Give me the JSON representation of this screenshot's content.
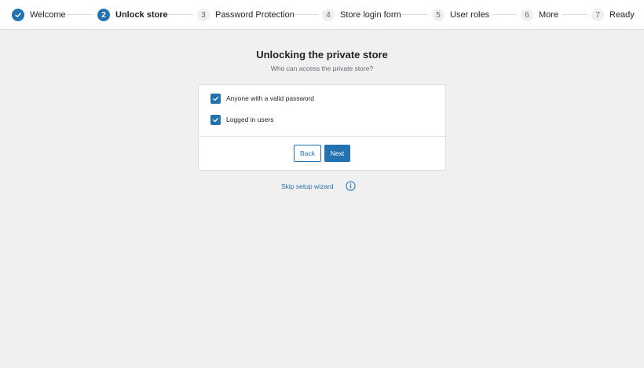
{
  "stepper": {
    "steps": [
      {
        "number": "",
        "label": "Welcome",
        "state": "done"
      },
      {
        "number": "2",
        "label": "Unlock store",
        "state": "active"
      },
      {
        "number": "3",
        "label": "Password Protection",
        "state": "todo"
      },
      {
        "number": "4",
        "label": "Store login form",
        "state": "todo"
      },
      {
        "number": "5",
        "label": "User roles",
        "state": "todo"
      },
      {
        "number": "6",
        "label": "More",
        "state": "todo"
      },
      {
        "number": "7",
        "label": "Ready",
        "state": "todo"
      }
    ]
  },
  "main": {
    "title": "Unlocking the private store",
    "subtitle": "Who can access the private store?",
    "options": [
      {
        "label": "Anyone with a valid password",
        "checked": true
      },
      {
        "label": "Logged in users",
        "checked": true
      }
    ],
    "back_label": "Back",
    "next_label": "Next",
    "skip_label": "Skip setup wizard"
  },
  "colors": {
    "accent": "#2271b1",
    "background": "#f0f0f1",
    "card": "#ffffff"
  },
  "icons": {
    "done_step": "check-icon",
    "checkbox": "check-icon",
    "help": "info-icon"
  }
}
